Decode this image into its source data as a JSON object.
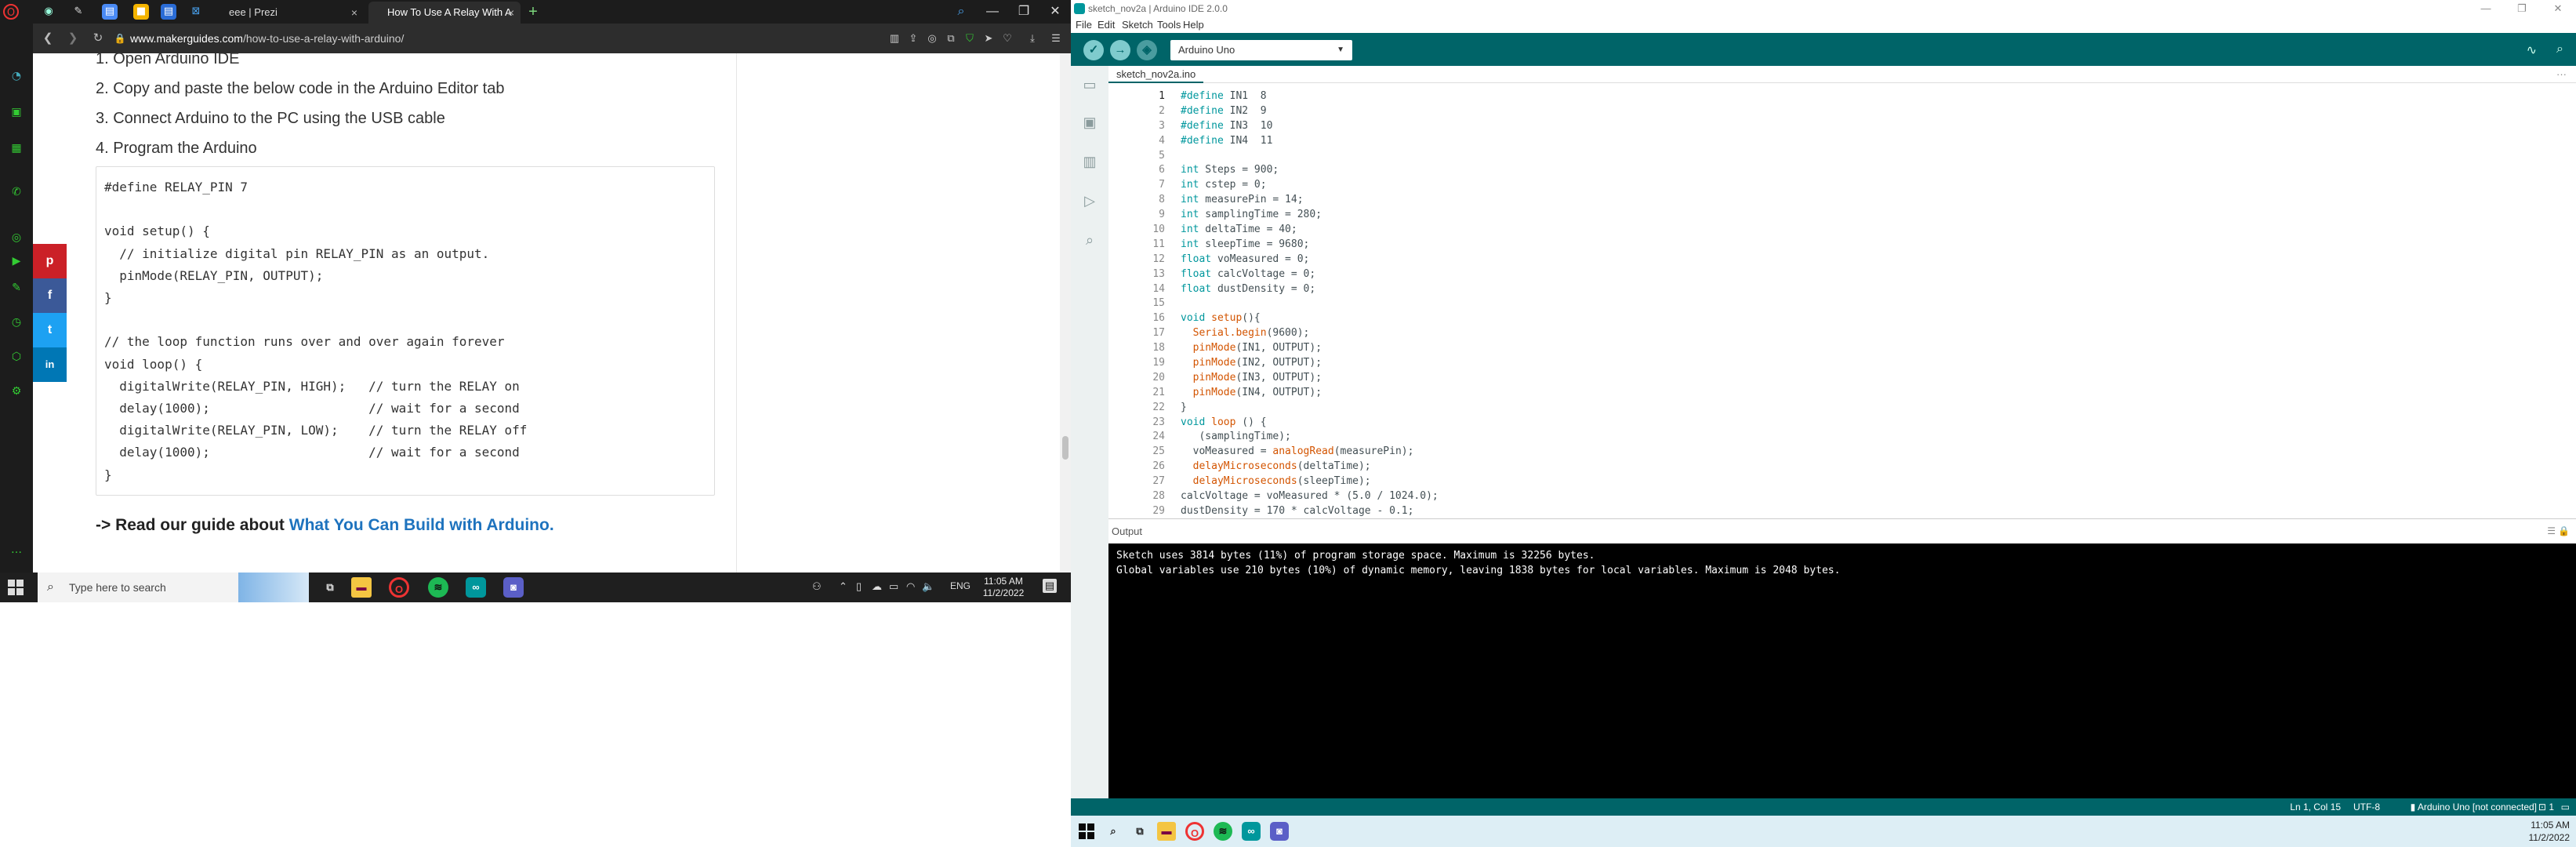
{
  "browser": {
    "tabs": [
      {
        "label": "eee | Prezi"
      },
      {
        "label": "How To Use A Relay With A"
      }
    ],
    "url_host": "www.makerguides.com",
    "url_path": "/how-to-use-a-relay-with-arduino/",
    "steps": [
      "1. Open Arduino IDE",
      "2. Copy and paste the below code in the Arduino Editor tab",
      "3. Connect Arduino to the PC using the USB cable",
      "4. Program the Arduino"
    ],
    "code_lines": [
      "#define RELAY_PIN 7",
      "",
      "void setup() {",
      "  // initialize digital pin RELAY_PIN as an output.",
      "  pinMode(RELAY_PIN, OUTPUT);",
      "}",
      "",
      "// the loop function runs over and over again forever",
      "void loop() {",
      "  digitalWrite(RELAY_PIN, HIGH);   // turn the RELAY on",
      "  delay(1000);                     // wait for a second",
      "  digitalWrite(RELAY_PIN, LOW);    // turn the RELAY off",
      "  delay(1000);                     // wait for a second",
      "}"
    ],
    "guide_prefix": "-> Read our guide about ",
    "guide_link": "What You Can Build with Arduino.",
    "share_buttons": [
      {
        "icon": "pinterest-icon",
        "glyph": "p",
        "color": "#cb2027"
      },
      {
        "icon": "facebook-icon",
        "glyph": "f",
        "color": "#3b5998"
      },
      {
        "icon": "twitter-icon",
        "glyph": "t",
        "color": "#1da1f2"
      },
      {
        "icon": "linkedin-icon",
        "glyph": "in",
        "color": "#0077b5"
      }
    ]
  },
  "taskbar_left": {
    "search_placeholder": "Type here to search",
    "language": "ENG",
    "time": "11:05 AM",
    "date": "11/2/2022"
  },
  "ide": {
    "title": "sketch_nov2a | Arduino IDE 2.0.0",
    "menus": [
      "File",
      "Edit",
      "Sketch",
      "Tools",
      "Help"
    ],
    "board": "Arduino Uno",
    "file_tab": "sketch_nov2a.ino",
    "line_numbers": [
      "1",
      "2",
      "3",
      "4",
      "5",
      "6",
      "7",
      "8",
      "9",
      "10",
      "11",
      "12",
      "13",
      "14",
      "15",
      "16",
      "17",
      "18",
      "19",
      "20",
      "21",
      "22",
      "23",
      "24",
      "25",
      "26",
      "27",
      "28",
      "29"
    ],
    "code_lines": [
      "#define IN1  8",
      "#define IN2  9",
      "#define IN3  10",
      "#define IN4  11",
      "",
      "int Steps = 900;",
      "int cstep = 0;",
      "int measurePin = 14;",
      "int samplingTime = 280;",
      "int deltaTime = 40;",
      "int sleepTime = 9680;",
      "float voMeasured = 0;",
      "float calcVoltage = 0;",
      "float dustDensity = 0;",
      "",
      "void setup(){",
      "  Serial.begin(9600);",
      "  pinMode(IN1, OUTPUT);",
      "  pinMode(IN2, OUTPUT);",
      "  pinMode(IN3, OUTPUT);",
      "  pinMode(IN4, OUTPUT);",
      "}",
      "void loop () {",
      "   (samplingTime);",
      "  voMeasured = analogRead(measurePin);",
      "  delayMicroseconds(deltaTime);",
      "  delayMicroseconds(sleepTime);",
      "calcVoltage = voMeasured * (5.0 / 1024.0);",
      "dustDensity = 170 * calcVoltage - 0.1;"
    ],
    "output_label": "Output",
    "output_lines": [
      "Sketch uses 3814 bytes (11%) of program storage space. Maximum is 32256 bytes.",
      "Global variables use 210 bytes (10%) of dynamic memory, leaving 1838 bytes for local variables. Maximum is 2048 bytes."
    ],
    "status": {
      "position": "Ln 1, Col 15",
      "encoding": "UTF-8",
      "board": "Arduino Uno [not connected]",
      "notifications": "1"
    }
  },
  "taskbar_right": {
    "time": "11:05 AM",
    "date": "11/2/2022"
  },
  "colors": {
    "ide_teal": "#006468",
    "ide_accent": "#00979c",
    "link_blue": "#1e73be"
  }
}
